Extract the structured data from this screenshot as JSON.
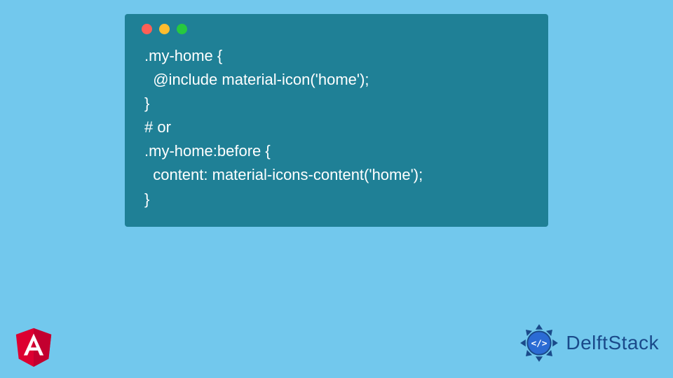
{
  "code": {
    "line1": ".my-home {",
    "line2": "  @include material-icon('home');",
    "line3": "}",
    "line4": "# or",
    "line5": ".my-home:before {",
    "line6": "  content: material-icons-content('home');",
    "line7": "}"
  },
  "brand": {
    "name": "DelftStack"
  }
}
